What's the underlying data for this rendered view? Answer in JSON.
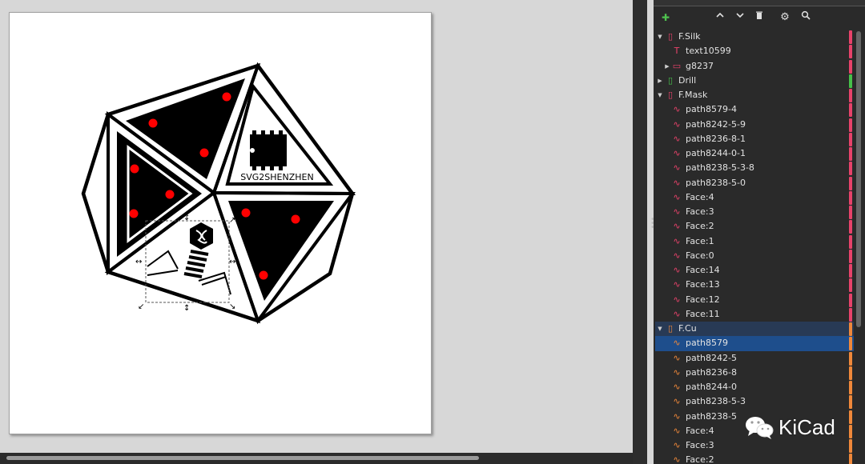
{
  "canvas": {
    "design_text": "SVG2SHENZHEN"
  },
  "objects_panel": {
    "toolbar": [
      {
        "name": "add-layer-icon",
        "glyph": "+"
      },
      {
        "name": "move-up-icon",
        "glyph": "∧"
      },
      {
        "name": "move-down-icon",
        "glyph": "∨"
      },
      {
        "name": "delete-icon",
        "glyph": "🗑"
      },
      {
        "name": "settings-icon",
        "glyph": "⚙"
      },
      {
        "name": "search-icon",
        "glyph": "⌕"
      }
    ],
    "rows": [
      {
        "label": "F.Silk",
        "depth": 0,
        "type": "layer",
        "expanded": true,
        "color": "#e8426a"
      },
      {
        "label": "text10599",
        "depth": 1,
        "type": "text",
        "color": "#e8426a"
      },
      {
        "label": "g8237",
        "depth": 1,
        "type": "group",
        "collapsed": true,
        "color": "#e8426a"
      },
      {
        "label": "Drill",
        "depth": 0,
        "type": "layer",
        "collapsed": true,
        "color": "#46c04a"
      },
      {
        "label": "F.Mask",
        "depth": 0,
        "type": "layer",
        "expanded": true,
        "color": "#e8426a"
      },
      {
        "label": "path8579-4",
        "depth": 1,
        "type": "path",
        "color": "#e8426a"
      },
      {
        "label": "path8242-5-9",
        "depth": 1,
        "type": "path",
        "color": "#e8426a"
      },
      {
        "label": "path8236-8-1",
        "depth": 1,
        "type": "path",
        "color": "#e8426a"
      },
      {
        "label": "path8244-0-1",
        "depth": 1,
        "type": "path",
        "color": "#e8426a"
      },
      {
        "label": "path8238-5-3-8",
        "depth": 1,
        "type": "path",
        "color": "#e8426a"
      },
      {
        "label": "path8238-5-0",
        "depth": 1,
        "type": "path",
        "color": "#e8426a"
      },
      {
        "label": "Face:4",
        "depth": 1,
        "type": "path",
        "color": "#e8426a"
      },
      {
        "label": "Face:3",
        "depth": 1,
        "type": "path",
        "color": "#e8426a"
      },
      {
        "label": "Face:2",
        "depth": 1,
        "type": "path",
        "color": "#e8426a"
      },
      {
        "label": "Face:1",
        "depth": 1,
        "type": "path",
        "color": "#e8426a"
      },
      {
        "label": "Face:0",
        "depth": 1,
        "type": "path",
        "color": "#e8426a"
      },
      {
        "label": "Face:14",
        "depth": 1,
        "type": "path",
        "color": "#e8426a"
      },
      {
        "label": "Face:13",
        "depth": 1,
        "type": "path",
        "color": "#e8426a"
      },
      {
        "label": "Face:12",
        "depth": 1,
        "type": "path",
        "color": "#e8426a"
      },
      {
        "label": "Face:11",
        "depth": 1,
        "type": "path",
        "color": "#e8426a"
      },
      {
        "label": "F.Cu",
        "depth": 0,
        "type": "layer",
        "expanded": true,
        "color": "#f0883a",
        "highlight": true
      },
      {
        "label": "path8579",
        "depth": 1,
        "type": "path",
        "color": "#f0883a",
        "selected": true
      },
      {
        "label": "path8242-5",
        "depth": 1,
        "type": "path",
        "color": "#f0883a"
      },
      {
        "label": "path8236-8",
        "depth": 1,
        "type": "path",
        "color": "#f0883a"
      },
      {
        "label": "path8244-0",
        "depth": 1,
        "type": "path",
        "color": "#f0883a"
      },
      {
        "label": "path8238-5-3",
        "depth": 1,
        "type": "path",
        "color": "#f0883a"
      },
      {
        "label": "path8238-5",
        "depth": 1,
        "type": "path",
        "color": "#f0883a"
      },
      {
        "label": "Face:4",
        "depth": 1,
        "type": "path",
        "color": "#f0883a"
      },
      {
        "label": "Face:3",
        "depth": 1,
        "type": "path",
        "color": "#f0883a"
      },
      {
        "label": "Face:2",
        "depth": 1,
        "type": "path",
        "color": "#f0883a"
      }
    ]
  },
  "watermark": {
    "text": "KiCad"
  }
}
